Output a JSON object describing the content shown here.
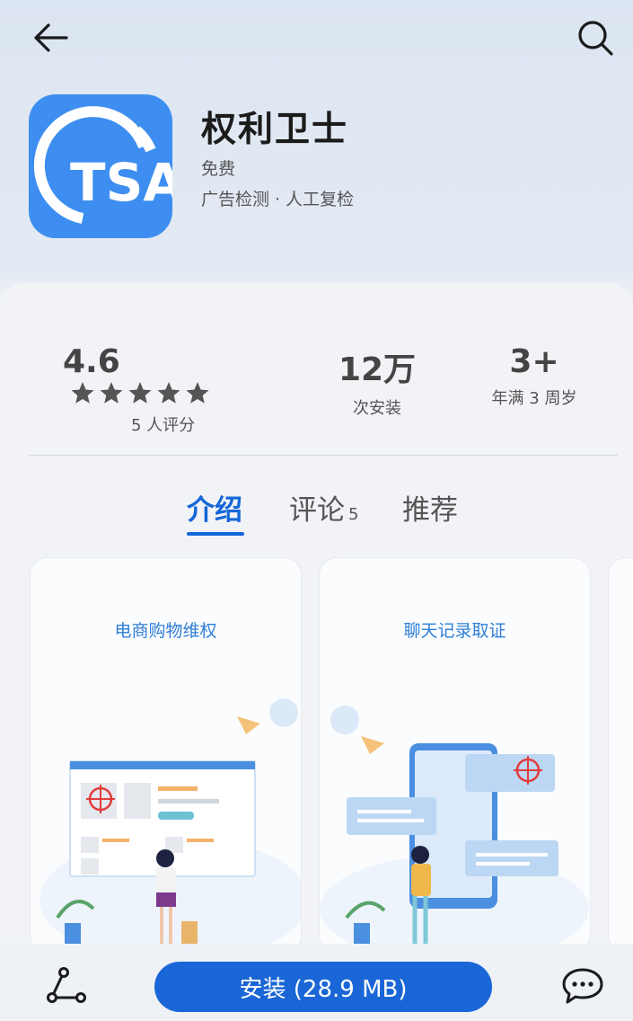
{
  "topbar": {
    "back_icon": "arrow-left-icon",
    "search_icon": "search-icon"
  },
  "app": {
    "name": "权利卫士",
    "price": "免费",
    "tags": "广告检测 · 人工复检",
    "icon_text": "TSA",
    "icon_color": "#3d8ef0"
  },
  "stats": {
    "rating": {
      "value": "4.6",
      "stars": 5,
      "caption": "5 人评分"
    },
    "installs": {
      "value": "12万",
      "caption": "次安装"
    },
    "age": {
      "value": "3+",
      "caption": "年满 3 周岁"
    }
  },
  "tabs": [
    {
      "label": "介绍",
      "active": true
    },
    {
      "label": "评论",
      "badge": "5"
    },
    {
      "label": "推荐"
    }
  ],
  "screenshots": [
    {
      "title": "电商购物维权"
    },
    {
      "title": "聊天记录取证"
    },
    {
      "title": ""
    }
  ],
  "bottombar": {
    "share_icon": "share-icon",
    "install_label": "安装 (28.9 MB)",
    "chat_icon": "chat-bubble-icon"
  },
  "colors": {
    "accent": "#1467d8",
    "install_button": "#1a66d6"
  }
}
